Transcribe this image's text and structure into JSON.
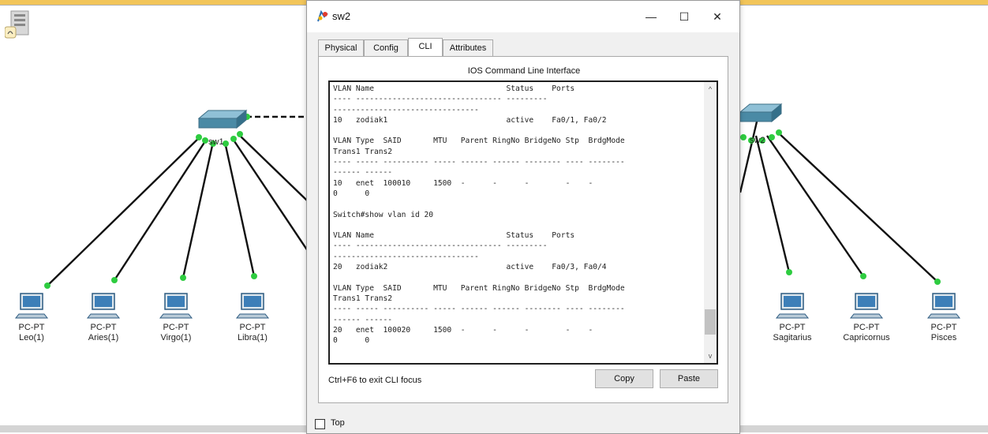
{
  "dialog": {
    "title": "sw2",
    "controls": {
      "minimize": "—",
      "maximize": "☐",
      "close": "✕"
    },
    "tabs": [
      {
        "label": "Physical",
        "active": false
      },
      {
        "label": "Config",
        "active": false
      },
      {
        "label": "CLI",
        "active": true
      },
      {
        "label": "Attributes",
        "active": false
      }
    ],
    "cli_heading": "IOS Command Line Interface",
    "cli_output": "VLAN Name                             Status    Ports\n---- -------------------------------- ---------\n--------------------------------\n10   zodiak1                          active    Fa0/1, Fa0/2\n\nVLAN Type  SAID       MTU   Parent RingNo BridgeNo Stp  BrdgMode\nTrans1 Trans2\n---- ----- ---------- ----- ------ ------ -------- ---- --------\n------ ------\n10   enet  100010     1500  -      -      -        -    -\n0      0\n\nSwitch#show vlan id 20\n\nVLAN Name                             Status    Ports\n---- -------------------------------- ---------\n--------------------------------\n20   zodiak2                          active    Fa0/3, Fa0/4\n\nVLAN Type  SAID       MTU   Parent RingNo BridgeNo Stp  BrdgMode\nTrans1 Trans2\n---- ----- ---------- ----- ------ ------ -------- ---- --------\n------ ------\n20   enet  100020     1500  -      -      -        -    -\n0      0",
    "exit_hint": "Ctrl+F6 to exit CLI focus",
    "copy_label": "Copy",
    "paste_label": "Paste",
    "top_label": "Top",
    "top_checked": false,
    "scroll_up_glyph": "^",
    "scroll_down_glyph": "v"
  },
  "topology": {
    "left_switch_label": "sw1",
    "right_switch_label": "sw2",
    "pcs_left": [
      {
        "type": "PC-PT",
        "name": "Leo(1)"
      },
      {
        "type": "PC-PT",
        "name": "Aries(1)"
      },
      {
        "type": "PC-PT",
        "name": "Virgo(1)"
      },
      {
        "type": "PC-PT",
        "name": "Libra(1)"
      }
    ],
    "pcs_right": [
      {
        "type": "PC-PT",
        "name": "Sagitarius"
      },
      {
        "type": "PC-PT",
        "name": "Capricornus"
      },
      {
        "type": "PC-PT",
        "name": "Pisces"
      }
    ]
  },
  "colors": {
    "link": "#111111",
    "link_up": "#2ecc40",
    "switch_body": "#4a8aa5",
    "pc_screen": "#3d7fb8"
  }
}
